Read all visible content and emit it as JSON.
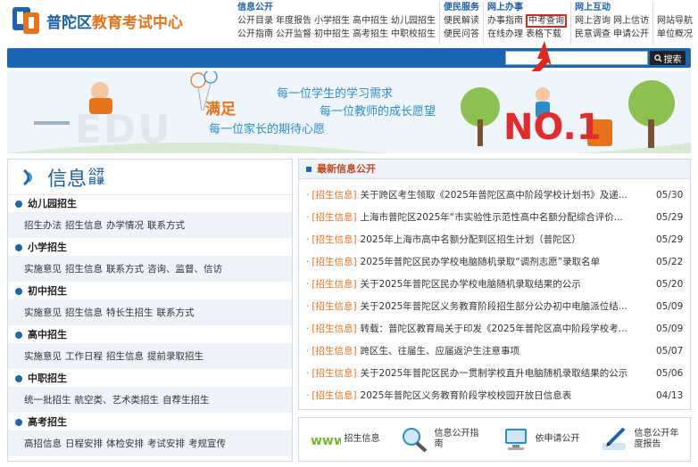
{
  "logo": {
    "text_main": "普陀区",
    "text_accent": "教育考试中心"
  },
  "nav": [
    {
      "title": "信息公开",
      "rows": [
        [
          "公开目录",
          "年度报告",
          "小学招生",
          "高中招生",
          "幼儿园招生"
        ],
        [
          "公开指南",
          "公开监督",
          "初中招生",
          "高考招生",
          "中职校招生"
        ]
      ]
    },
    {
      "title": "便民服务",
      "rows": [
        [
          "便民解读"
        ],
        [
          "便民问答"
        ]
      ]
    },
    {
      "title": "网上办事",
      "rows": [
        [
          "办事指南",
          "中考查询"
        ],
        [
          "在线办理",
          "表格下载"
        ]
      ]
    },
    {
      "title": "网上互动",
      "rows": [
        [
          "网上咨询",
          "网上信访"
        ],
        [
          "民意调查",
          "申请公开"
        ]
      ]
    },
    {
      "title": "",
      "rows": [
        [
          "网站导航"
        ],
        [
          "单位概况"
        ]
      ]
    }
  ],
  "search": {
    "placeholder": "",
    "button_label": "搜索"
  },
  "banner": {
    "main": "满足",
    "line1": "每一位学生的学习需求",
    "line2": "每一位教师的成长愿望",
    "line3": "每一位家长的期待心愿",
    "edu": "EDU",
    "no1": "NO.1"
  },
  "info": {
    "big": "信息",
    "small1": "公开",
    "small2": "目录"
  },
  "categories": [
    {
      "title": "幼儿园招生",
      "links": [
        "招生办法",
        "招生信息",
        "办学情况",
        "联系方式"
      ]
    },
    {
      "title": "小学招生",
      "links": [
        "实施意见",
        "招生信息",
        "联系方式",
        "咨询、监督、信访"
      ]
    },
    {
      "title": "初中招生",
      "links": [
        "实施意见",
        "招生信息",
        "特长生招生",
        "联系方式"
      ]
    },
    {
      "title": "高中招生",
      "links": [
        "实施意见",
        "工作日程",
        "招生信息",
        "提前录取招生"
      ]
    },
    {
      "title": "中职招生",
      "links": [
        "统一批招生",
        "航空类、艺术类招生",
        "自荐生招生"
      ]
    },
    {
      "title": "高考招生",
      "links": [
        "高招信息",
        "日程安排",
        "体检安排",
        "考试安排",
        "考规宣传"
      ]
    }
  ],
  "news": {
    "title": "最新信息公开",
    "items": [
      {
        "cat": "[招生信息]",
        "title": "关于跨区考生领取《2025年普陀区高中阶段学校计划书》及递...",
        "date": "05/30"
      },
      {
        "cat": "[招生信息]",
        "title": "上海市普陀区2025年“市实验性示范性高中名额分配综合评价...",
        "date": "05/29"
      },
      {
        "cat": "[招生信息]",
        "title": "2025年上海市高中名额分配到区招生计划（普陀区）",
        "date": "05/29"
      },
      {
        "cat": "[招生信息]",
        "title": "2025年普陀区民办学校电脑随机录取“调剂志愿”录取名单",
        "date": "05/22"
      },
      {
        "cat": "[招生信息]",
        "title": "关于2025年普陀区民办学校电脑随机录取结果的公示",
        "date": "05/20"
      },
      {
        "cat": "[招生信息]",
        "title": "关于2025年普陀区义务教育阶段招生部分公办初中电脑派位结...",
        "date": "05/09"
      },
      {
        "cat": "[招生信息]",
        "title": "转载：普陀区教育局关于印发《2025年普陀区高中阶段学校考...",
        "date": "05/09"
      },
      {
        "cat": "[招生信息]",
        "title": "跨区生、往届生、应届返沪生注意事项",
        "date": "05/07"
      },
      {
        "cat": "[招生信息]",
        "title": "关于2025年普陀区民办一贯制学校直升电脑随机录取结果的公示",
        "date": "05/06"
      },
      {
        "cat": "[招生信息]",
        "title": "2025年普陀区义务教育阶段学校校园开放日信息表",
        "date": "04/13"
      }
    ]
  },
  "quick": [
    {
      "label": "招生信息",
      "icon": "www-icon"
    },
    {
      "label": "信息公开指南",
      "icon": "magnifier-icon"
    },
    {
      "label": "依申请公开",
      "icon": "computer-icon"
    },
    {
      "label": "信息公开年度报告",
      "icon": "pen-icon"
    }
  ],
  "colors": {
    "brand": "#1a5fa8",
    "accent": "#e8731b",
    "highlight": "#e0271e",
    "bar": "#1a66b3"
  }
}
